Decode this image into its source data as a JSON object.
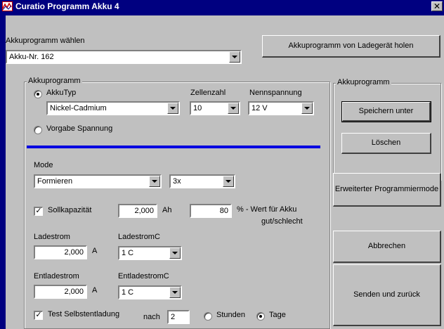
{
  "window": {
    "title": "Curatio Programm Akku 4",
    "close_glyph": "✕"
  },
  "select_program": {
    "label": "Akkuprogramm wählen",
    "value": "Akku-Nr. 162",
    "fetch_button": "Akkuprogramm von Ladegerät holen"
  },
  "program_group": {
    "title": "Akkuprogramm",
    "akkutyp_label": "AkkuTyp",
    "akkutyp_value": "Nickel-Cadmium",
    "zellenzahl_label": "Zellenzahl",
    "zellenzahl_value": "10",
    "nennspannung_label": "Nennspannung",
    "nennspannung_value": "12 V",
    "vorgabe_label": "Vorgabe Spannung",
    "mode_label": "Mode",
    "mode_value": "Formieren",
    "repeat_value": "3x",
    "sollkap_label": "Sollkapazität",
    "sollkap_value": "2,000",
    "sollkap_unit": "Ah",
    "percent_value": "80",
    "percent_label_1": "% - Wert für Akku",
    "percent_label_2": "gut/schlecht",
    "ladestrom_label": "Ladestrom",
    "ladestrom_value": "2,000",
    "ladestrom_unit": "A",
    "ladestromc_label": "LadestromC",
    "ladestromc_value": "1 C",
    "entladestrom_label": "Entladestrom",
    "entladestrom_value": "2,000",
    "entladestrom_unit": "A",
    "entladestromc_label": "EntladestromC",
    "entladestromc_value": "1 C",
    "selbstentladung_label": "Test Selbstentladung",
    "nach_label": "nach",
    "nach_value": "2",
    "stunden_label": "Stunden",
    "tage_label": "Tage"
  },
  "right_group": {
    "title": "Akkuprogramm",
    "save_button": "Speichern unter",
    "delete_button": "Löschen"
  },
  "buttons": {
    "extended_mode": "Erweiterter Programmiermode",
    "cancel": "Abbrechen",
    "send_back": "Senden und zurück"
  },
  "colors": {
    "title_bar": "#000080",
    "face": "#c0c0c0",
    "separator": "#0000e0"
  }
}
